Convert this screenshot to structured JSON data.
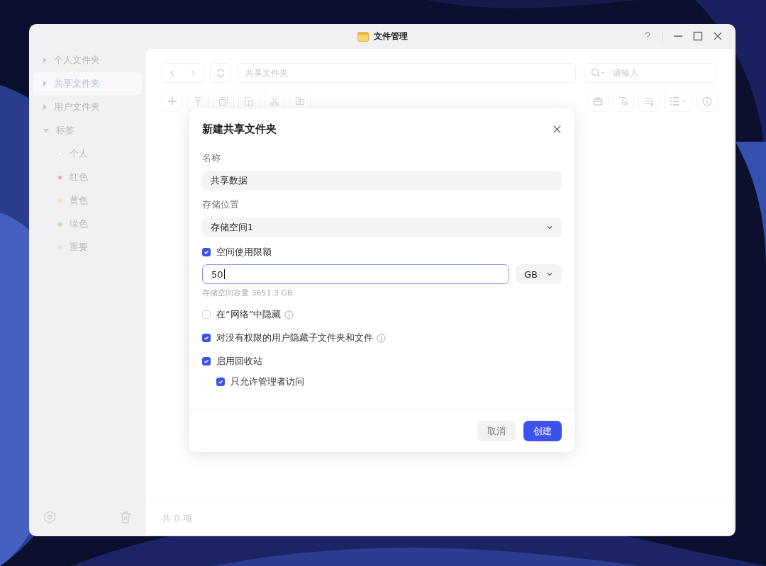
{
  "window": {
    "title": "文件管理"
  },
  "sidebar": {
    "items": [
      {
        "label": "个人文件夹",
        "expanded": false,
        "selected": false
      },
      {
        "label": "共享文件夹",
        "expanded": false,
        "selected": true
      },
      {
        "label": "用户文件夹",
        "expanded": false,
        "selected": false
      },
      {
        "label": "标签",
        "expanded": true,
        "selected": false,
        "children": [
          {
            "label": "个人",
            "color": "#ffffff",
            "selected": false
          },
          {
            "label": "红色",
            "color": "#f2aaa2",
            "selected": false
          },
          {
            "label": "黄色",
            "color": "#f7eaa6",
            "selected": false
          },
          {
            "label": "绿色",
            "color": "#aedcac",
            "selected": false
          },
          {
            "label": "重要",
            "color": "#e4e4e8",
            "selected": false
          }
        ]
      }
    ]
  },
  "toolbar": {
    "path": "共享文件夹",
    "search": {
      "placeholder": "请输入"
    }
  },
  "status_bar": {
    "text": "共 0 项"
  },
  "dialog": {
    "title": "新建共享文件夹",
    "name": {
      "label": "名称",
      "value": "共享数据"
    },
    "location": {
      "label": "存储位置",
      "value": "存储空间1"
    },
    "quota": {
      "label": "空间使用限额",
      "checked": true,
      "value": "50",
      "unit": "GB",
      "hint": "存储空间容量 3651.3 GB"
    },
    "options": [
      {
        "label": "在“网络”中隐藏",
        "checked": false,
        "info": true
      },
      {
        "label": "对没有权限的用户隐藏子文件夹和文件",
        "checked": true,
        "info": true
      },
      {
        "label": "启用回收站",
        "checked": true,
        "children": [
          {
            "label": "只允许管理者访问",
            "checked": true
          }
        ]
      }
    ],
    "buttons": [
      {
        "label": "取消",
        "kind": "secondary"
      },
      {
        "label": "创建",
        "kind": "primary"
      }
    ]
  }
}
